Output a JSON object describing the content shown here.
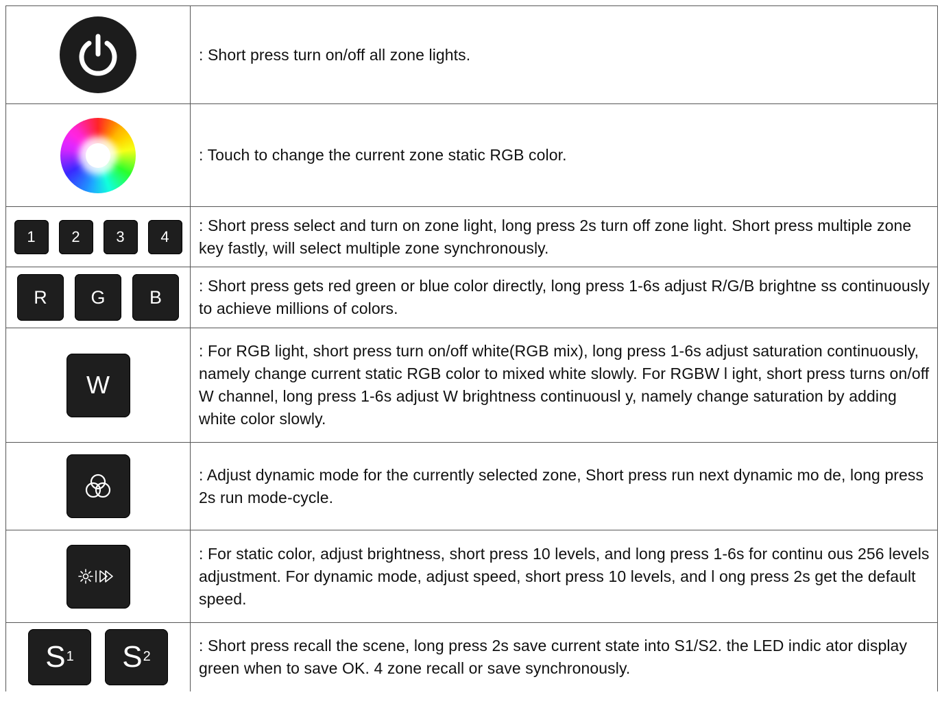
{
  "rows": [
    {
      "icon": "power-icon",
      "desc": ": Short press turn on/off all zone lights."
    },
    {
      "icon": "color-wheel-icon",
      "desc": ": Touch to change the current zone static RGB color."
    },
    {
      "icon": "zone-keys",
      "keys": [
        "1",
        "2",
        "3",
        "4"
      ],
      "desc": ": Short press select and turn on zone light, long press 2s turn off zone light. Short press multiple zone key fastly, will select multiple zone synchronously."
    },
    {
      "icon": "rgb-keys",
      "keys": [
        "R",
        "G",
        "B"
      ],
      "desc": ": Short press gets red green or blue color directly, long press 1-6s adjust R/G/B brightne ss continuously to achieve millions of colors."
    },
    {
      "icon": "w-key",
      "key": "W",
      "desc": ": For RGB light, short press turn on/off white(RGB mix), long press 1-6s adjust saturation continuously, namely change current static RGB color to mixed white slowly. For RGBW l ight, short press turns on/off W channel, long press 1-6s adjust W brightness continuousl y, namely change saturation by adding white color slowly."
    },
    {
      "icon": "mode-icon",
      "desc": ": Adjust dynamic mode for the currently selected zone, Short press run next dynamic mo de, long press 2s run mode-cycle."
    },
    {
      "icon": "brightness-speed-icon",
      "desc": ": For static color, adjust brightness, short press 10 levels, and long press 1-6s for continu ous 256 levels adjustment. For dynamic mode, adjust speed, short press 10 levels, and l ong press 2s get the default speed."
    },
    {
      "icon": "scene-keys",
      "keys": [
        {
          "letter": "S",
          "sub": "1"
        },
        {
          "letter": "S",
          "sub": "2"
        }
      ],
      "desc": ": Short press recall the scene, long press 2s save current state into S1/S2. the LED indic ator display green when to save OK. 4 zone recall or save synchronously."
    }
  ]
}
